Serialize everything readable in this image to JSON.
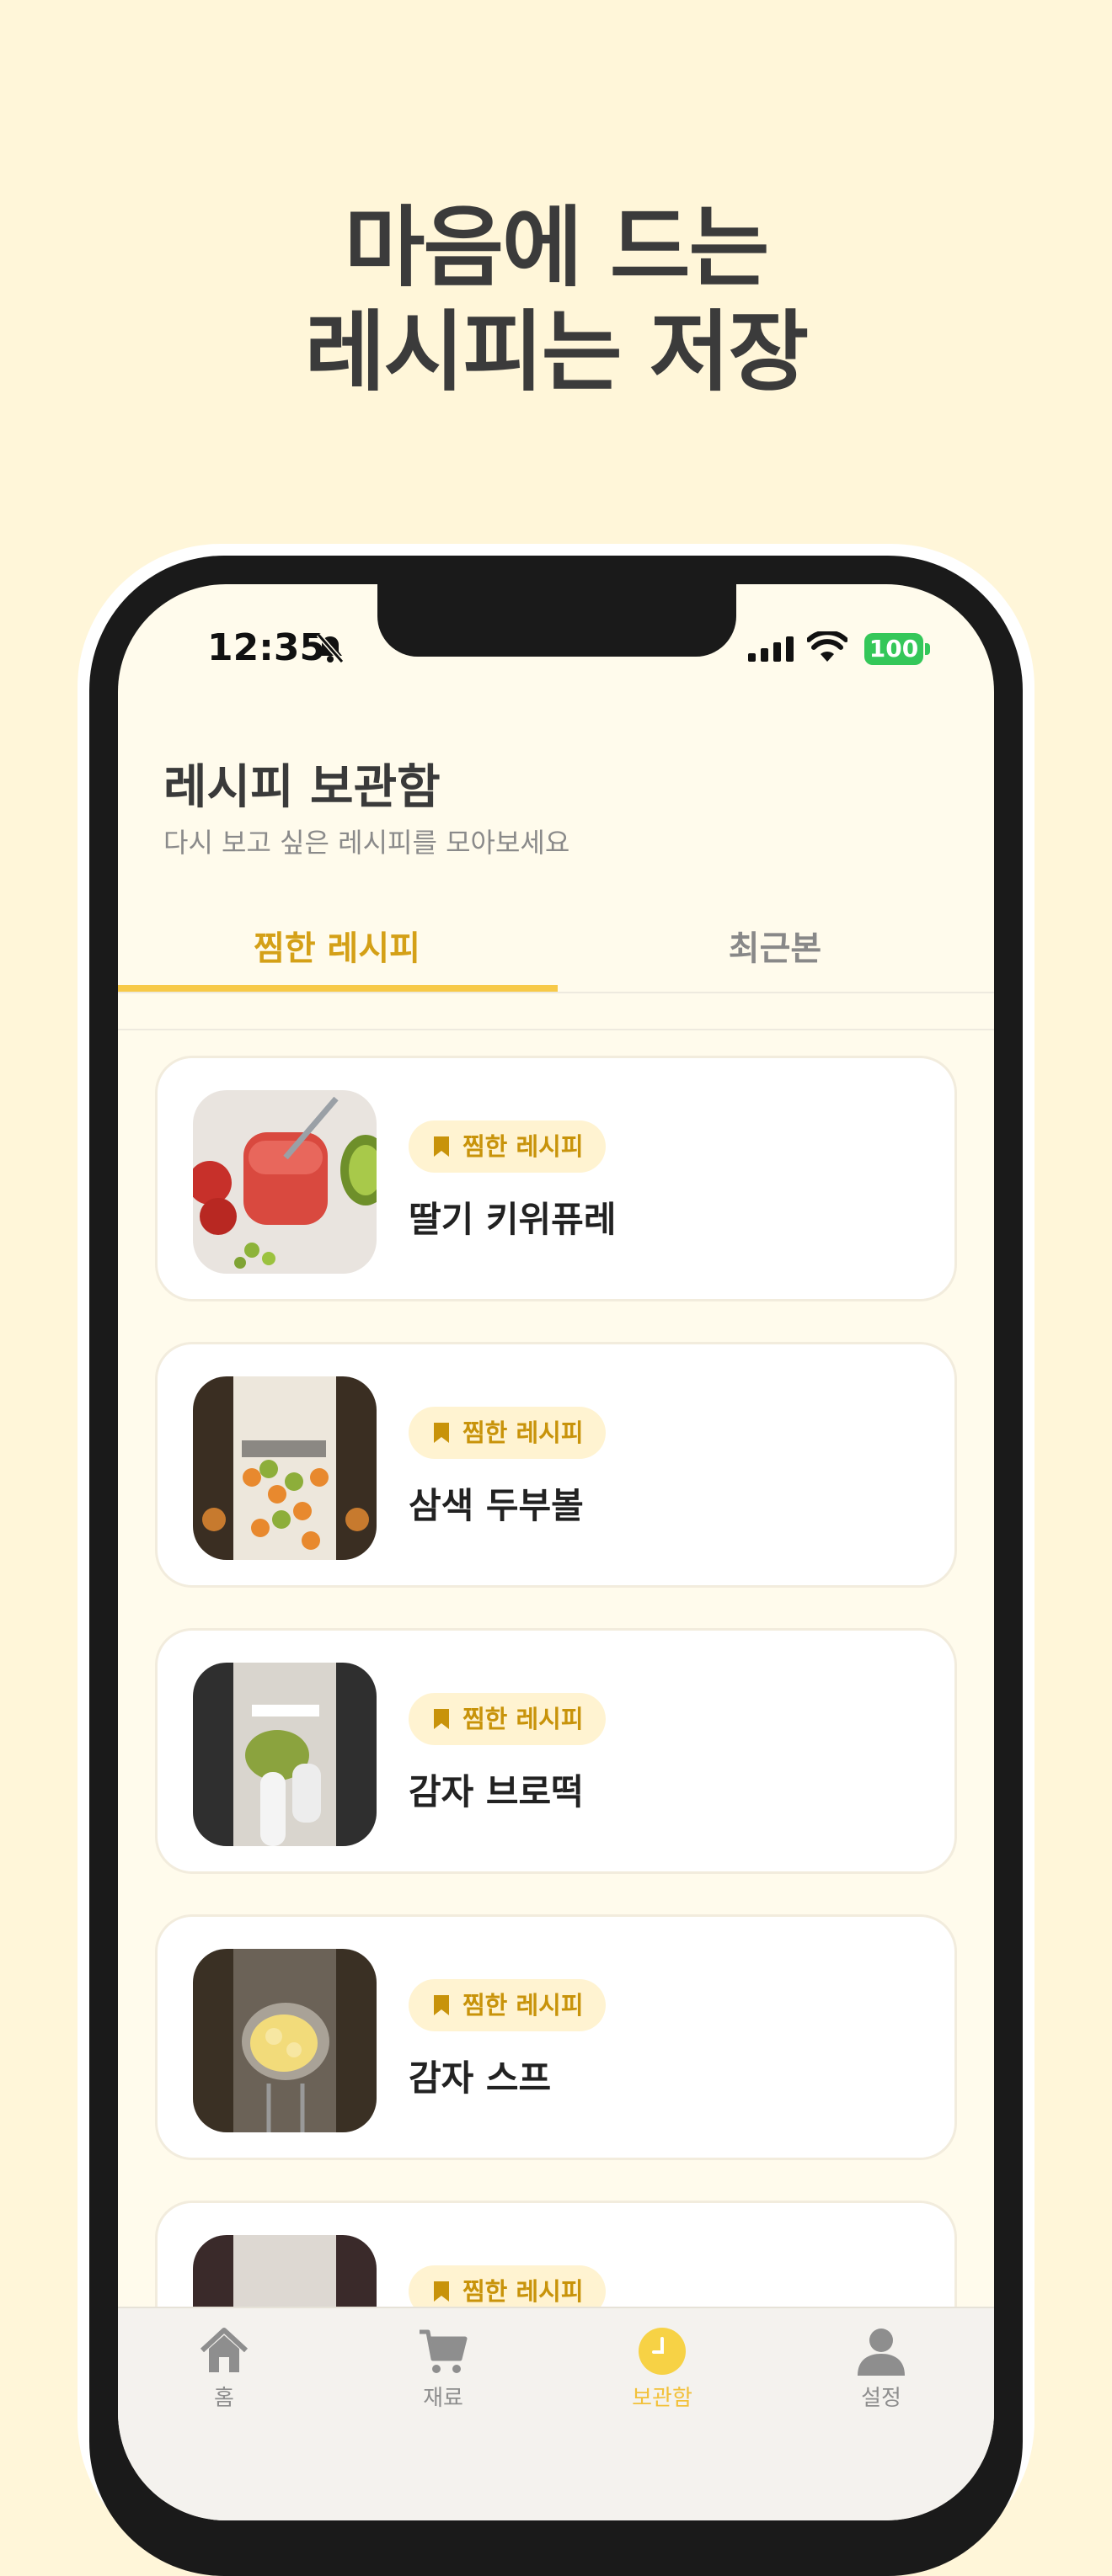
{
  "headline": {
    "line1": "마음에 드는",
    "line2": "레시피는 저장"
  },
  "status_bar": {
    "time": "12:35",
    "battery": "100"
  },
  "page": {
    "title": "레시피 보관함",
    "subtitle": "다시 보고 싶은 레시피를 모아보세요"
  },
  "tabs": [
    {
      "label": "찜한 레시피",
      "active": true
    },
    {
      "label": "최근본",
      "active": false
    }
  ],
  "recipes": [
    {
      "badge": "찜한 레시피",
      "title": "딸기 키위퓨레"
    },
    {
      "badge": "찜한 레시피",
      "title": "삼색 두부볼"
    },
    {
      "badge": "찜한 레시피",
      "title": "감자 브로떡"
    },
    {
      "badge": "찜한 레시피",
      "title": "감자 스프"
    },
    {
      "badge": "찜한 레시피",
      "title": ""
    }
  ],
  "tabbar": [
    {
      "label": "홈",
      "icon": "home-icon"
    },
    {
      "label": "재료",
      "icon": "cart-icon"
    },
    {
      "label": "보관함",
      "icon": "clock-icon",
      "active": true
    },
    {
      "label": "설정",
      "icon": "person-icon"
    }
  ],
  "colors": {
    "background": "#FFF6D9",
    "accent": "#D4A017",
    "underline": "#F7C948",
    "badge_bg": "#FFF3D1"
  }
}
